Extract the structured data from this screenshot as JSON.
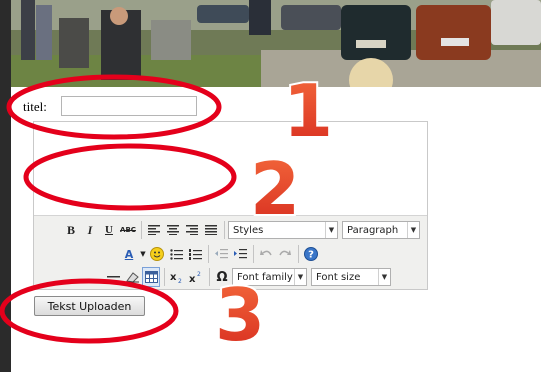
{
  "form": {
    "title_label": "titel:",
    "title_value": "",
    "upload_label": "Tekst Uploaden"
  },
  "toolbar": {
    "styles_label": "Styles",
    "format_label": "Paragraph",
    "font_family_label": "Font family",
    "font_size_label": "Font size",
    "icons": {
      "bold": "B",
      "italic": "I",
      "underline": "U",
      "strikethrough": "ABC",
      "omega": "Ω",
      "text_color": "A"
    }
  },
  "annotations": {
    "marker_1": "1",
    "marker_2": "2",
    "marker_3": "3",
    "color_marker_fill": "#e63b25",
    "color_ellipse": "#e4001b"
  }
}
